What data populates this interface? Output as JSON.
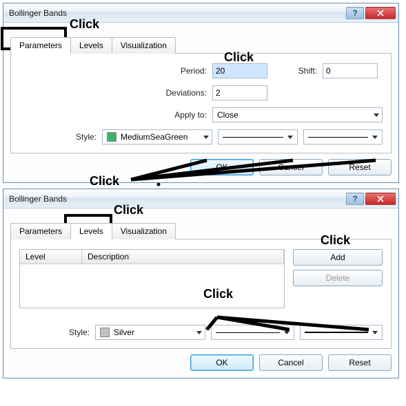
{
  "dialog1": {
    "title": "Bollinger Bands",
    "tabs": {
      "parameters": "Parameters",
      "levels": "Levels",
      "visualization": "Visualization"
    },
    "labels": {
      "period": "Period:",
      "shift": "Shift:",
      "deviations": "Deviations:",
      "applyto": "Apply to:",
      "style": "Style:"
    },
    "values": {
      "period": "20",
      "shift": "0",
      "deviations": "2",
      "applyto": "Close",
      "styleColorName": "MediumSeaGreen",
      "styleColorHex": "#3cb371"
    },
    "buttons": {
      "ok": "OK",
      "cancel": "Cancel",
      "reset": "Reset"
    }
  },
  "dialog2": {
    "title": "Bollinger Bands",
    "tabs": {
      "parameters": "Parameters",
      "levels": "Levels",
      "visualization": "Visualization"
    },
    "table": {
      "col1": "Level",
      "col2": "Description"
    },
    "labels": {
      "style": "Style:"
    },
    "values": {
      "styleColorName": "Silver",
      "styleColorHex": "#c0c0c0"
    },
    "buttons": {
      "ok": "OK",
      "cancel": "Cancel",
      "reset": "Reset",
      "add": "Add",
      "delete": "Delete"
    }
  },
  "annotations": {
    "click": "Click"
  }
}
